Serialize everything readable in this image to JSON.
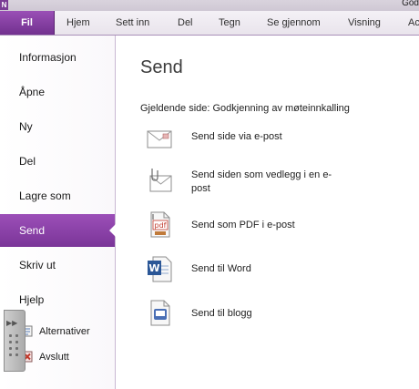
{
  "app": {
    "logo_letter": "N",
    "title_fragment": "God"
  },
  "ribbon": {
    "file_tab": "Fil",
    "tabs": [
      "Hjem",
      "Sett inn",
      "Del",
      "Tegn",
      "Se gjennom",
      "Visning",
      "Ac"
    ]
  },
  "nav": {
    "items": [
      "Informasjon",
      "Åpne",
      "Ny",
      "Del",
      "Lagre som",
      "Send",
      "Skriv ut",
      "Hjelp"
    ],
    "active": "Send",
    "small_items": [
      "Alternativer",
      "Avslutt"
    ]
  },
  "main": {
    "title": "Send",
    "current_page_label": "Gjeldende side: Godkjenning av møteinnkalling",
    "options": [
      {
        "label": "Send side via e-post",
        "icon": "envelope-icon"
      },
      {
        "label": "Send siden som vedlegg i en e-post",
        "icon": "envelope-attachment-icon"
      },
      {
        "label": "Send som PDF i e-post",
        "icon": "pdf-icon"
      },
      {
        "label": "Send til Word",
        "icon": "word-icon"
      },
      {
        "label": "Send til blogg",
        "icon": "blog-icon"
      }
    ]
  },
  "colors": {
    "accent": "#7a3598",
    "accent_light": "#9c4fb8"
  }
}
